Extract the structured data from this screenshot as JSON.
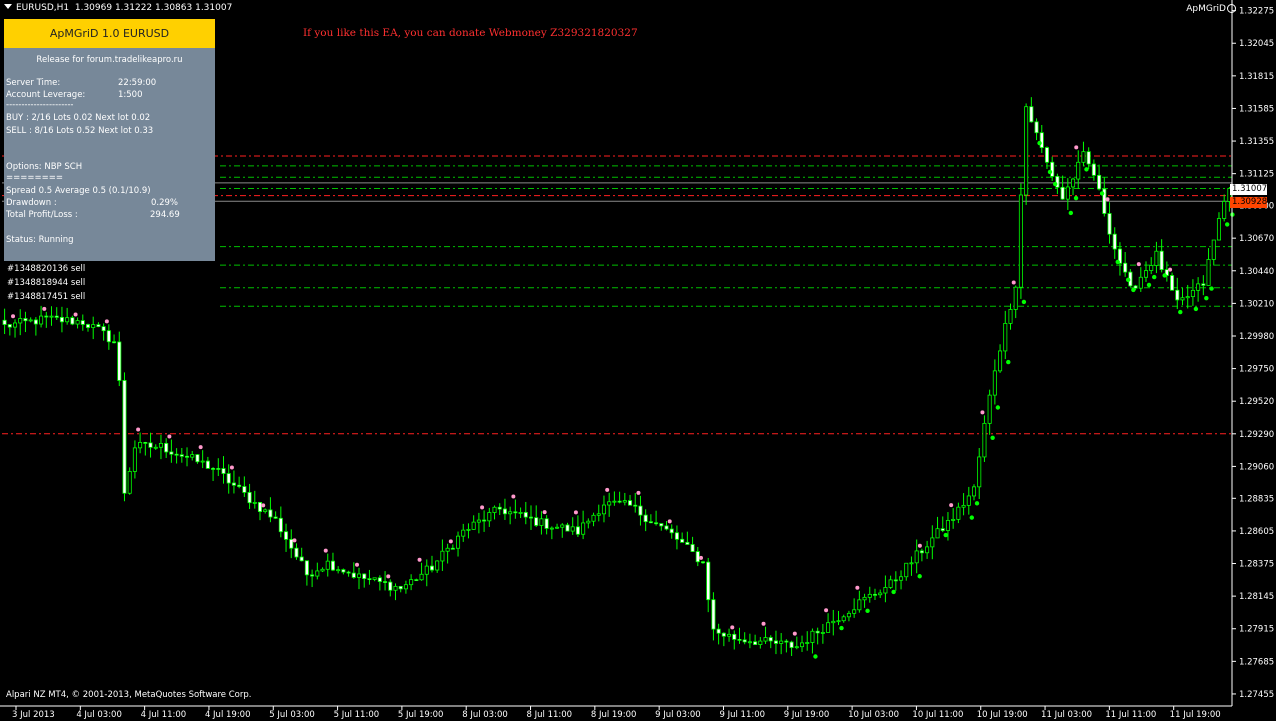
{
  "header": {
    "symbol": "EURUSD,H1",
    "ohlc": "1.30969 1.31222 1.30863 1.31007",
    "ea_name": "ApMGriD"
  },
  "donate_text": "If you like this EA, you can donate Webmoney Z329321820327",
  "panel": {
    "title": "ApMGriD 1.0 EURUSD",
    "release": "Release for forum.tradelikeapro.ru",
    "server_time_label": "Server Time:",
    "server_time": "22:59:00",
    "leverage_label": "Account Leverage:",
    "leverage": "1:500",
    "separator1": "----------------------",
    "buy": "BUY : 2/16  Lots 0.02 Next lot 0.02",
    "sell": "SELL : 8/16  Lots 0.52 Next lot 0.33",
    "options": "Options: NBP SCH",
    "separator2": "========",
    "spread": "Spread 0.5 Average 0.5 (0.1/10.9)",
    "drawdown_label": "Drawdown :",
    "drawdown": "0.29%",
    "profit_label": "Total Profit/Loss :",
    "profit": "294.69",
    "status": "Status: Running"
  },
  "orders": [
    "#1348820136 sell",
    "#1348818944 sell",
    "#1348817451 sell"
  ],
  "footer": "Alpari NZ MT4, © 2001-2013, MetaQuotes Software Corp.",
  "colors": {
    "bull": "#00ff00",
    "bear_body": "#ffffff",
    "level_red": "#ff2020",
    "level_green": "#00c000",
    "bid_tag": "#ffffff",
    "ask_tag": "#ff4500",
    "marker_up": "#00ff00",
    "marker_dn": "#ff99cc"
  },
  "chart_data": {
    "type": "candlestick",
    "symbol": "EURUSD",
    "timeframe": "H1",
    "ylim": [
      1.2737,
      1.3235
    ],
    "price_ticks": [
      "1.32275",
      "1.32045",
      "1.31815",
      "1.31585",
      "1.31355",
      "1.31125",
      "1.30900",
      "1.30670",
      "1.30440",
      "1.30210",
      "1.29980",
      "1.29750",
      "1.29520",
      "1.29290",
      "1.29060",
      "1.28835",
      "1.28605",
      "1.28375",
      "1.28145",
      "1.27915",
      "1.27685",
      "1.27455"
    ],
    "time_ticks": [
      "3 Jul 2013",
      "4 Jul 03:00",
      "4 Jul 11:00",
      "4 Jul 19:00",
      "5 Jul 03:00",
      "5 Jul 11:00",
      "5 Jul 19:00",
      "8 Jul 03:00",
      "8 Jul 11:00",
      "8 Jul 19:00",
      "9 Jul 03:00",
      "9 Jul 11:00",
      "9 Jul 19:00",
      "10 Jul 03:00",
      "10 Jul 11:00",
      "10 Jul 19:00",
      "11 Jul 03:00",
      "11 Jul 11:00",
      "11 Jul 19:00"
    ],
    "bid": "1.31007",
    "ask": "1.30928",
    "red_levels": [
      1.3125,
      1.3097,
      1.2929
    ],
    "green_levels": [
      1.3118,
      1.311,
      1.3102,
      1.3061,
      1.3048,
      1.3032,
      1.3019
    ],
    "grey_levels": [
      1.3106,
      1.3093
    ],
    "anchors": [
      [
        0,
        1.3005
      ],
      [
        8,
        1.301
      ],
      [
        15,
        1.3008
      ],
      [
        18,
        1.3002
      ],
      [
        21,
        1.2994
      ],
      [
        22,
        1.2965
      ],
      [
        23,
        1.2888
      ],
      [
        25,
        1.292
      ],
      [
        30,
        1.292
      ],
      [
        40,
        1.2905
      ],
      [
        48,
        1.288
      ],
      [
        52,
        1.2868
      ],
      [
        58,
        1.283
      ],
      [
        62,
        1.2838
      ],
      [
        68,
        1.2828
      ],
      [
        76,
        1.282
      ],
      [
        82,
        1.2835
      ],
      [
        88,
        1.286
      ],
      [
        95,
        1.2876
      ],
      [
        103,
        1.2866
      ],
      [
        110,
        1.286
      ],
      [
        115,
        1.288
      ],
      [
        120,
        1.2878
      ],
      [
        128,
        1.2858
      ],
      [
        134,
        1.2838
      ],
      [
        136,
        1.279
      ],
      [
        140,
        1.2785
      ],
      [
        152,
        1.2779
      ],
      [
        158,
        1.2795
      ],
      [
        164,
        1.281
      ],
      [
        170,
        1.2823
      ],
      [
        178,
        1.2855
      ],
      [
        182,
        1.287
      ],
      [
        186,
        1.289
      ],
      [
        188,
        1.2935
      ],
      [
        190,
        1.2975
      ],
      [
        194,
        1.3035
      ],
      [
        196,
        1.316
      ],
      [
        200,
        1.312
      ],
      [
        203,
        1.3095
      ],
      [
        207,
        1.3125
      ],
      [
        209,
        1.3112
      ],
      [
        213,
        1.306
      ],
      [
        216,
        1.303
      ],
      [
        221,
        1.3055
      ],
      [
        225,
        1.302
      ],
      [
        230,
        1.3035
      ],
      [
        233,
        1.308
      ],
      [
        235,
        1.3105
      ]
    ]
  }
}
